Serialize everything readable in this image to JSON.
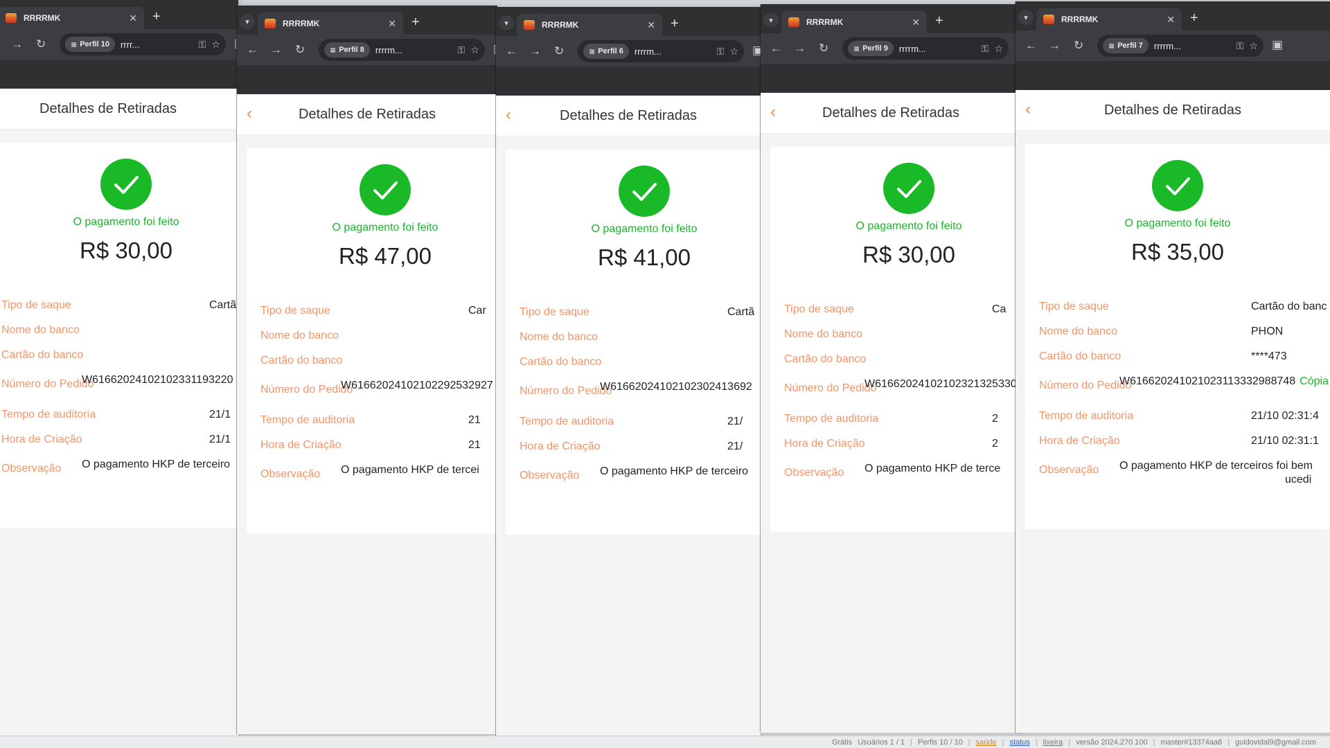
{
  "app": {
    "page_title": "Detalhes de Retiradas",
    "status_text": "O pagamento foi feito",
    "labels": {
      "tipo": "Tipo de saque",
      "nome_banco": "Nome do banco",
      "cartao": "Cartão do banco",
      "pedido": "Número do Pedido",
      "auditoria": "Tempo de auditoria",
      "criacao": "Hora de Criação",
      "observacao": "Observação"
    },
    "accent_color": "#1ab927",
    "label_color": "#f0956a"
  },
  "windows": [
    {
      "tab_title": "RRRRMK",
      "profile": "Perfil 10",
      "omnibox": "rrrr...",
      "amount": "R$ 30,00",
      "tipo": "Cartã",
      "nome_banco": "",
      "cartao": "",
      "pedido": "W61662024102102331193220",
      "auditoria": "21/1",
      "criacao": "21/1",
      "observacao": "O pagamento HKP de terceiro",
      "copy": ""
    },
    {
      "tab_title": "RRRRMK",
      "profile": "Perfil 8",
      "omnibox": "rrrrm...",
      "amount": "R$ 47,00",
      "tipo": "Car",
      "nome_banco": "",
      "cartao": "",
      "pedido": "W61662024102102292532927",
      "auditoria": "21",
      "criacao": "21",
      "observacao": "O pagamento HKP de tercei",
      "copy": ""
    },
    {
      "tab_title": "RRRRMK",
      "profile": "Perfil 6",
      "omnibox": "rrrrm...",
      "amount": "R$ 41,00",
      "tipo": "Cartã",
      "nome_banco": "",
      "cartao": "",
      "pedido": "W61662024102102302413692",
      "auditoria": "21/",
      "criacao": "21/",
      "observacao": "O pagamento HKP de terceiro",
      "copy": ""
    },
    {
      "tab_title": "RRRRMK",
      "profile": "Perfil 9",
      "omnibox": "rrrrm...",
      "amount": "R$ 30,00",
      "tipo": "Ca",
      "nome_banco": "",
      "cartao": "",
      "pedido": "W61662024102102321325330",
      "auditoria": "2",
      "criacao": "2",
      "observacao": "O pagamento HKP de terce",
      "copy": ""
    },
    {
      "tab_title": "RRRRMK",
      "profile": "Perfil 7",
      "omnibox": "rrrrm...",
      "amount": "R$ 35,00",
      "tipo": "Cartão do banc",
      "nome_banco": "PHON",
      "cartao": "****473",
      "pedido": "W616620241021023113332988748",
      "auditoria": "21/10 02:31:4",
      "criacao": "21/10 02:31:1",
      "observacao": "O pagamento HKP de terceiros foi bem",
      "observacao2": "ucedi",
      "copy": "Cópia"
    }
  ],
  "statusbar": {
    "plan": "Grátis",
    "users": "Usuários 1 / 1",
    "profiles": "Perfis 10 / 10",
    "health": "saúde",
    "status": "status",
    "trash": "lixeira",
    "version": "versão 2024.270.100",
    "build": "master#13374aa8",
    "email": "guidovidal9@gmail.com"
  }
}
